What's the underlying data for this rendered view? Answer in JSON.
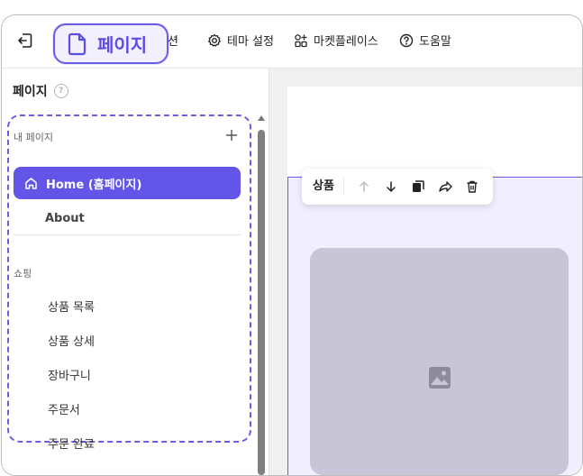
{
  "toolbar": {
    "page_label": "페이지",
    "section_label_partial": "섹션",
    "theme_label": "테마 설정",
    "marketplace_label": "마켓플레이스",
    "help_label": "도움말"
  },
  "sidebar": {
    "title": "페이지",
    "help_icon_glyph": "?",
    "my_pages_label": "내 페이지",
    "my_pages": [
      {
        "label": "Home (홈페이지)",
        "active": true
      },
      {
        "label": "About",
        "active": false
      }
    ],
    "shop_label": "쇼핑",
    "shop_pages": [
      {
        "label": "상품 목록"
      },
      {
        "label": "상품 상세"
      },
      {
        "label": "장바구니"
      },
      {
        "label": "주문서"
      },
      {
        "label": "주문 완료"
      }
    ]
  },
  "canvas": {
    "block_label": "상품"
  },
  "colors": {
    "accent": "#6255e8",
    "highlight_border": "#6b5ce7",
    "placeholder": "#c8c5d6"
  }
}
